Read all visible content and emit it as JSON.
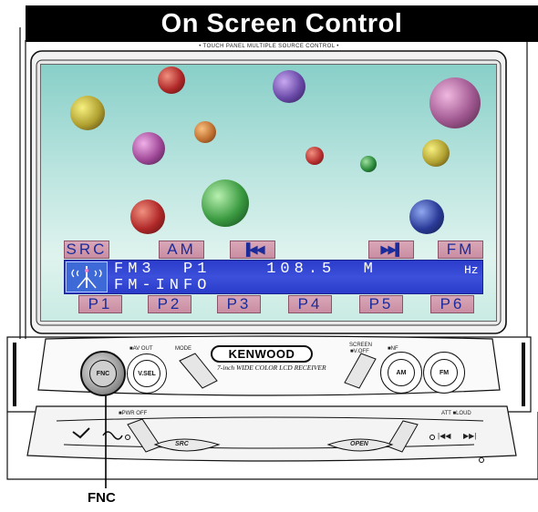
{
  "page": {
    "title": "On Screen Control"
  },
  "unit": {
    "caption": "• TOUCH PANEL MULTIPLE SOURCE CONTROL •",
    "brand": "KENWOOD",
    "model": "7-inch WIDE COLOR LCD RECEIVER"
  },
  "screen": {
    "top_buttons": {
      "src": "SRC",
      "am": "AM",
      "prev": "▐◀◀",
      "next": "▶▶▌",
      "fm": "FM"
    },
    "info": {
      "line1": "FM3  P1    108.5  M",
      "hz": "Hz",
      "line2": "FM-INFO"
    },
    "presets": [
      "P1",
      "P2",
      "P3",
      "P4",
      "P5",
      "P6"
    ]
  },
  "faceplate": {
    "fnc": "FNC",
    "vsel": "V.SEL",
    "am": "AM",
    "fm": "FM",
    "src": "SRC",
    "open": "OPEN",
    "labels": {
      "av_out": "■AV OUT",
      "mode": "MODE",
      "screen": "SCREEN",
      "v_off": "■V.OFF",
      "nf": "■NF",
      "pwr_off": "■PWR OFF",
      "att_loud": "ATT ■LOUD"
    }
  },
  "callout": {
    "label": "FNC"
  },
  "colors": {
    "screen_button": "#c98da2",
    "screen_button_text": "#1b2c9a",
    "info_panel": "#2a3cc9",
    "title_bar": "#000000"
  }
}
